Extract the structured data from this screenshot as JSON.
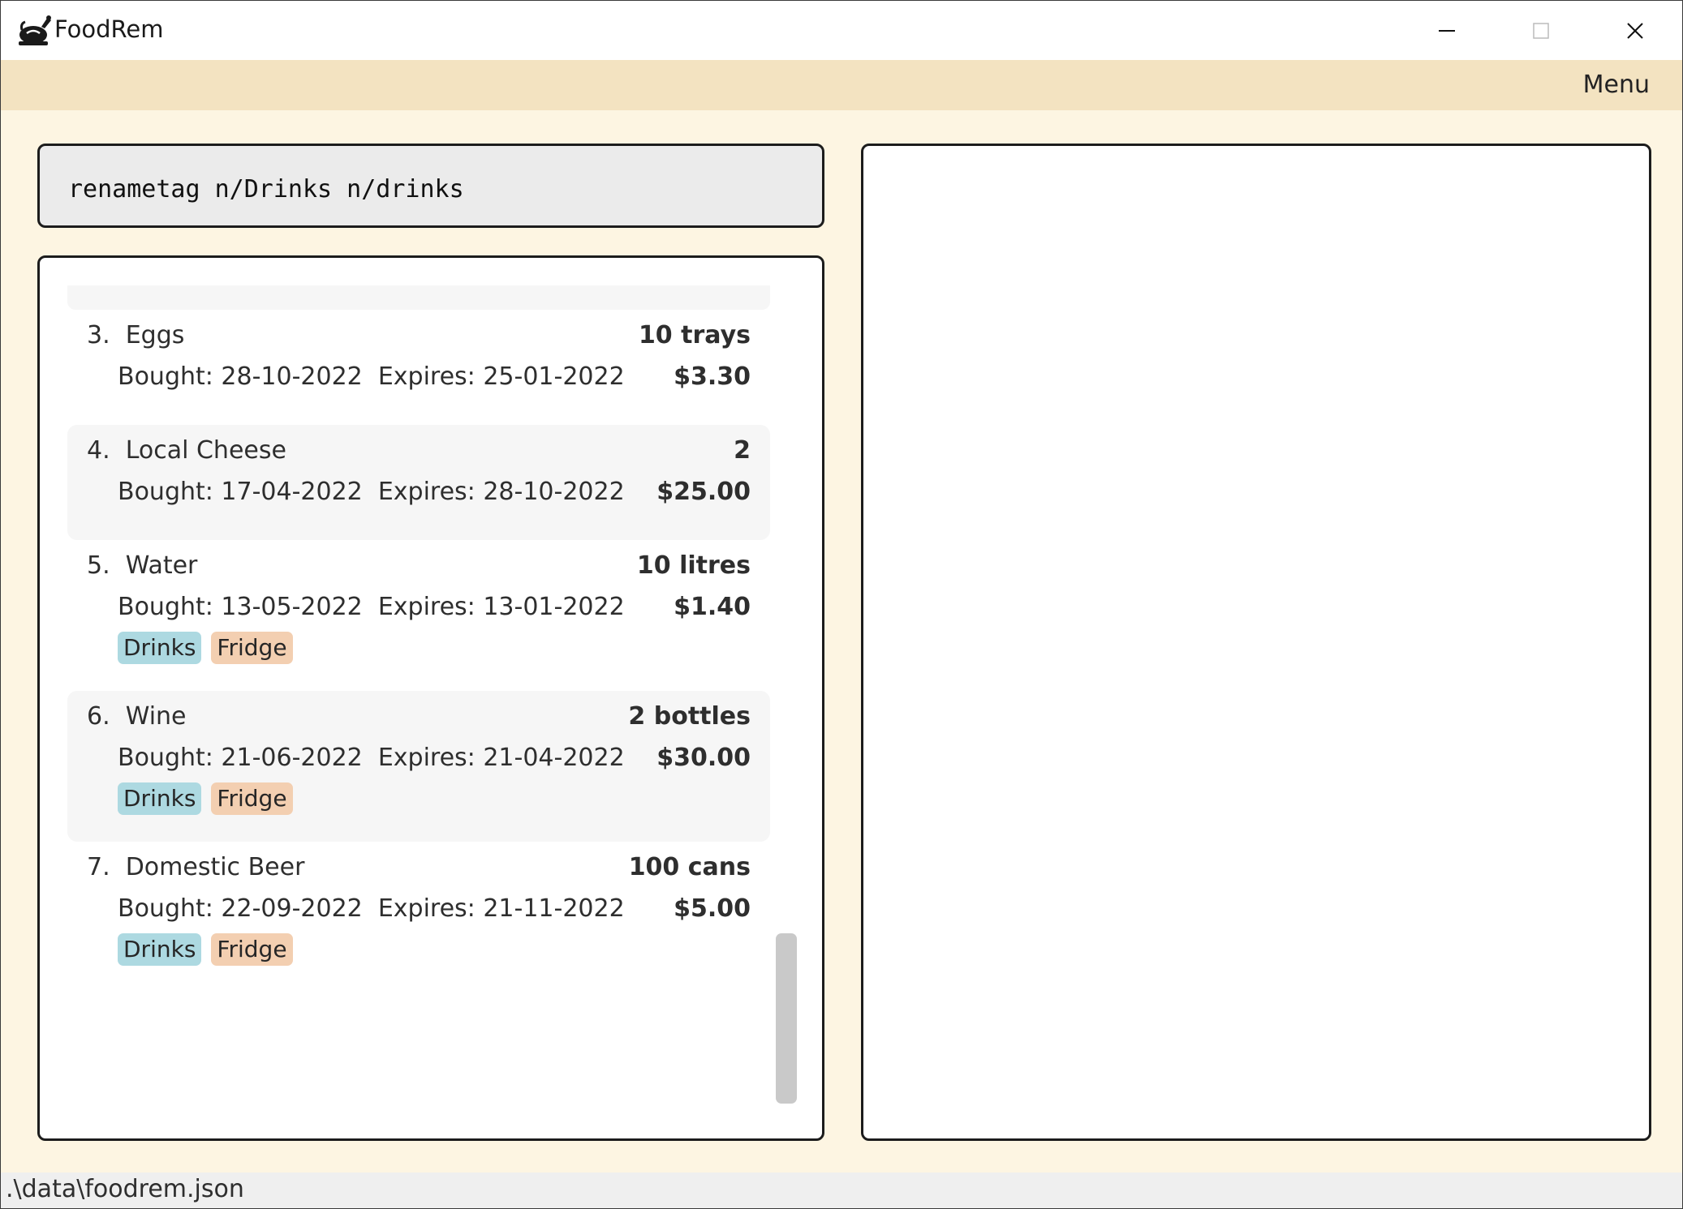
{
  "window": {
    "title": "FoodRem",
    "icon": "roast-chicken-icon",
    "controls": {
      "minimize": "minimize-icon",
      "maximize": "maximize-icon",
      "close": "close-icon"
    }
  },
  "menubar": {
    "menu_label": "Menu"
  },
  "command_box": {
    "value": "renametag n/Drinks n/drinks"
  },
  "items": [
    {
      "name": "3.  Eggs",
      "quantity": "10 trays",
      "dates": "Bought: 28-10-2022  Expires: 25-01-2022",
      "price": "$3.30",
      "tags": []
    },
    {
      "name": "4.  Local Cheese",
      "quantity": "2",
      "dates": "Bought: 17-04-2022  Expires: 28-10-2022",
      "price": "$25.00",
      "tags": []
    },
    {
      "name": "5.  Water",
      "quantity": "10 litres",
      "dates": "Bought: 13-05-2022  Expires: 13-01-2022",
      "price": "$1.40",
      "tags": [
        "Drinks",
        "Fridge"
      ]
    },
    {
      "name": "6.  Wine",
      "quantity": "2 bottles",
      "dates": "Bought: 21-06-2022  Expires: 21-04-2022",
      "price": "$30.00",
      "tags": [
        "Drinks",
        "Fridge"
      ]
    },
    {
      "name": "7.  Domestic Beer",
      "quantity": "100 cans",
      "dates": "Bought: 22-09-2022  Expires: 21-11-2022",
      "price": "$5.00",
      "tags": [
        "Drinks",
        "Fridge"
      ]
    }
  ],
  "tag_colors": {
    "Drinks": "#add9e1",
    "Fridge": "#f3cfb1"
  },
  "status_bar": {
    "file_path": ".\\data\\foodrem.json"
  },
  "colors": {
    "background": "#fdf5e2",
    "menubar": "#f3e3c1",
    "command_box": "#ebebeb"
  }
}
